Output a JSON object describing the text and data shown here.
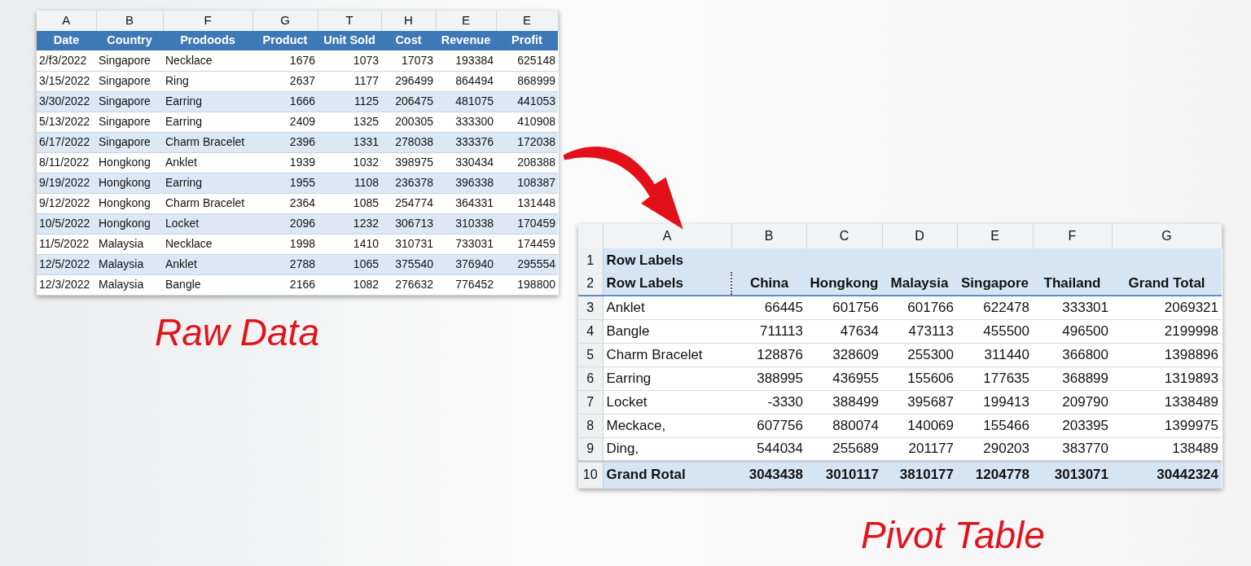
{
  "raw_data": {
    "column_letters": [
      "A",
      "B",
      "F",
      "G",
      "T",
      "H",
      "E",
      "E"
    ],
    "columns": [
      "Date",
      "Country",
      "Prodoods",
      "Product",
      "Unit Sold",
      "Cost",
      "Revenue",
      "Profit"
    ],
    "rows": [
      [
        "2/f3/2022",
        "Singapore",
        "Necklace",
        "1676",
        "1073",
        "17073",
        "193384",
        "625148"
      ],
      [
        "3/15/2022",
        "Singapore",
        "Ring",
        "2637",
        "1177",
        "296499",
        "864494",
        "868999"
      ],
      [
        "3/30/2022",
        "Singapore",
        "Earring",
        "1666",
        "1125",
        "206475",
        "481075",
        "441053"
      ],
      [
        "5/13/2022",
        "Singapore",
        "Earring",
        "2409",
        "1325",
        "200305",
        "333300",
        "410908"
      ],
      [
        "6/17/2022",
        "Singapore",
        "Charm Bracelet",
        "2396",
        "1331",
        "278038",
        "333376",
        "172038"
      ],
      [
        "8/11/2022",
        "Hongkong",
        "Anklet",
        "1939",
        "1032",
        "398975",
        "330434",
        "208388"
      ],
      [
        "9/19/2022",
        "Hongkong",
        "Earring",
        "1955",
        "1108",
        "236378",
        "396338",
        "108387"
      ],
      [
        "9/12/2022",
        "Hongkong",
        "Charm Bracelet",
        "2364",
        "1085",
        "254774",
        "364331",
        "131448"
      ],
      [
        "10/5/2022",
        "Hongkong",
        "Locket",
        "2096",
        "1232",
        "306713",
        "310338",
        "170459"
      ],
      [
        "11/5/2022",
        "Malaysia",
        "Necklace",
        "1998",
        "1410",
        "310731",
        "733031",
        "174459"
      ],
      [
        "12/5/2022",
        "Malaysia",
        "Anklet",
        "2788",
        "1065",
        "375540",
        "376940",
        "295554"
      ],
      [
        "12/3/2022",
        "Malaysia",
        "Bangle",
        "2166",
        "1082",
        "276632",
        "776452",
        "198800"
      ]
    ],
    "caption": "Raw Data"
  },
  "pivot_table": {
    "column_letters": [
      "A",
      "B",
      "C",
      "D",
      "E",
      "F",
      "G"
    ],
    "rows": [
      {
        "number": "1",
        "kind": "title",
        "cells": [
          "Row Labels"
        ]
      },
      {
        "number": "2",
        "kind": "header",
        "cells": [
          "Row Labels",
          "China",
          "Hongkong",
          "Malaysia",
          "Singapore",
          "Thailand",
          "Grand Total"
        ]
      },
      {
        "number": "3",
        "kind": "data",
        "cells": [
          "Anklet",
          "66445",
          "601756",
          "601766",
          "622478",
          "333301",
          "2069321"
        ]
      },
      {
        "number": "4",
        "kind": "data",
        "cells": [
          "Bangle",
          "711113",
          "47634",
          "473113",
          "455500",
          "496500",
          "2199998"
        ]
      },
      {
        "number": "5",
        "kind": "data",
        "cells": [
          "Charm Bracelet",
          "128876",
          "328609",
          "255300",
          "311440",
          "366800",
          "1398896"
        ]
      },
      {
        "number": "6",
        "kind": "data",
        "cells": [
          "Earring",
          "388995",
          "436955",
          "155606",
          "177635",
          "368899",
          "1319893"
        ]
      },
      {
        "number": "7",
        "kind": "data",
        "cells": [
          "Locket",
          "-3330",
          "388499",
          "395687",
          "199413",
          "209790",
          "1338489"
        ]
      },
      {
        "number": "8",
        "kind": "data",
        "cells": [
          "Meckace,",
          "607756",
          "880074",
          "140069",
          "155466",
          "203395",
          "1399975"
        ]
      },
      {
        "number": "9",
        "kind": "data",
        "cells": [
          "Ding,",
          "544034",
          "255689",
          "201177",
          "290203",
          "383770",
          "138489"
        ]
      },
      {
        "number": "10",
        "kind": "total",
        "cells": [
          "Grand Rotal",
          "3043438",
          "3010117",
          "3810177",
          "1204778",
          "3013071",
          "30442324"
        ]
      }
    ],
    "caption": "Pivot Table"
  }
}
